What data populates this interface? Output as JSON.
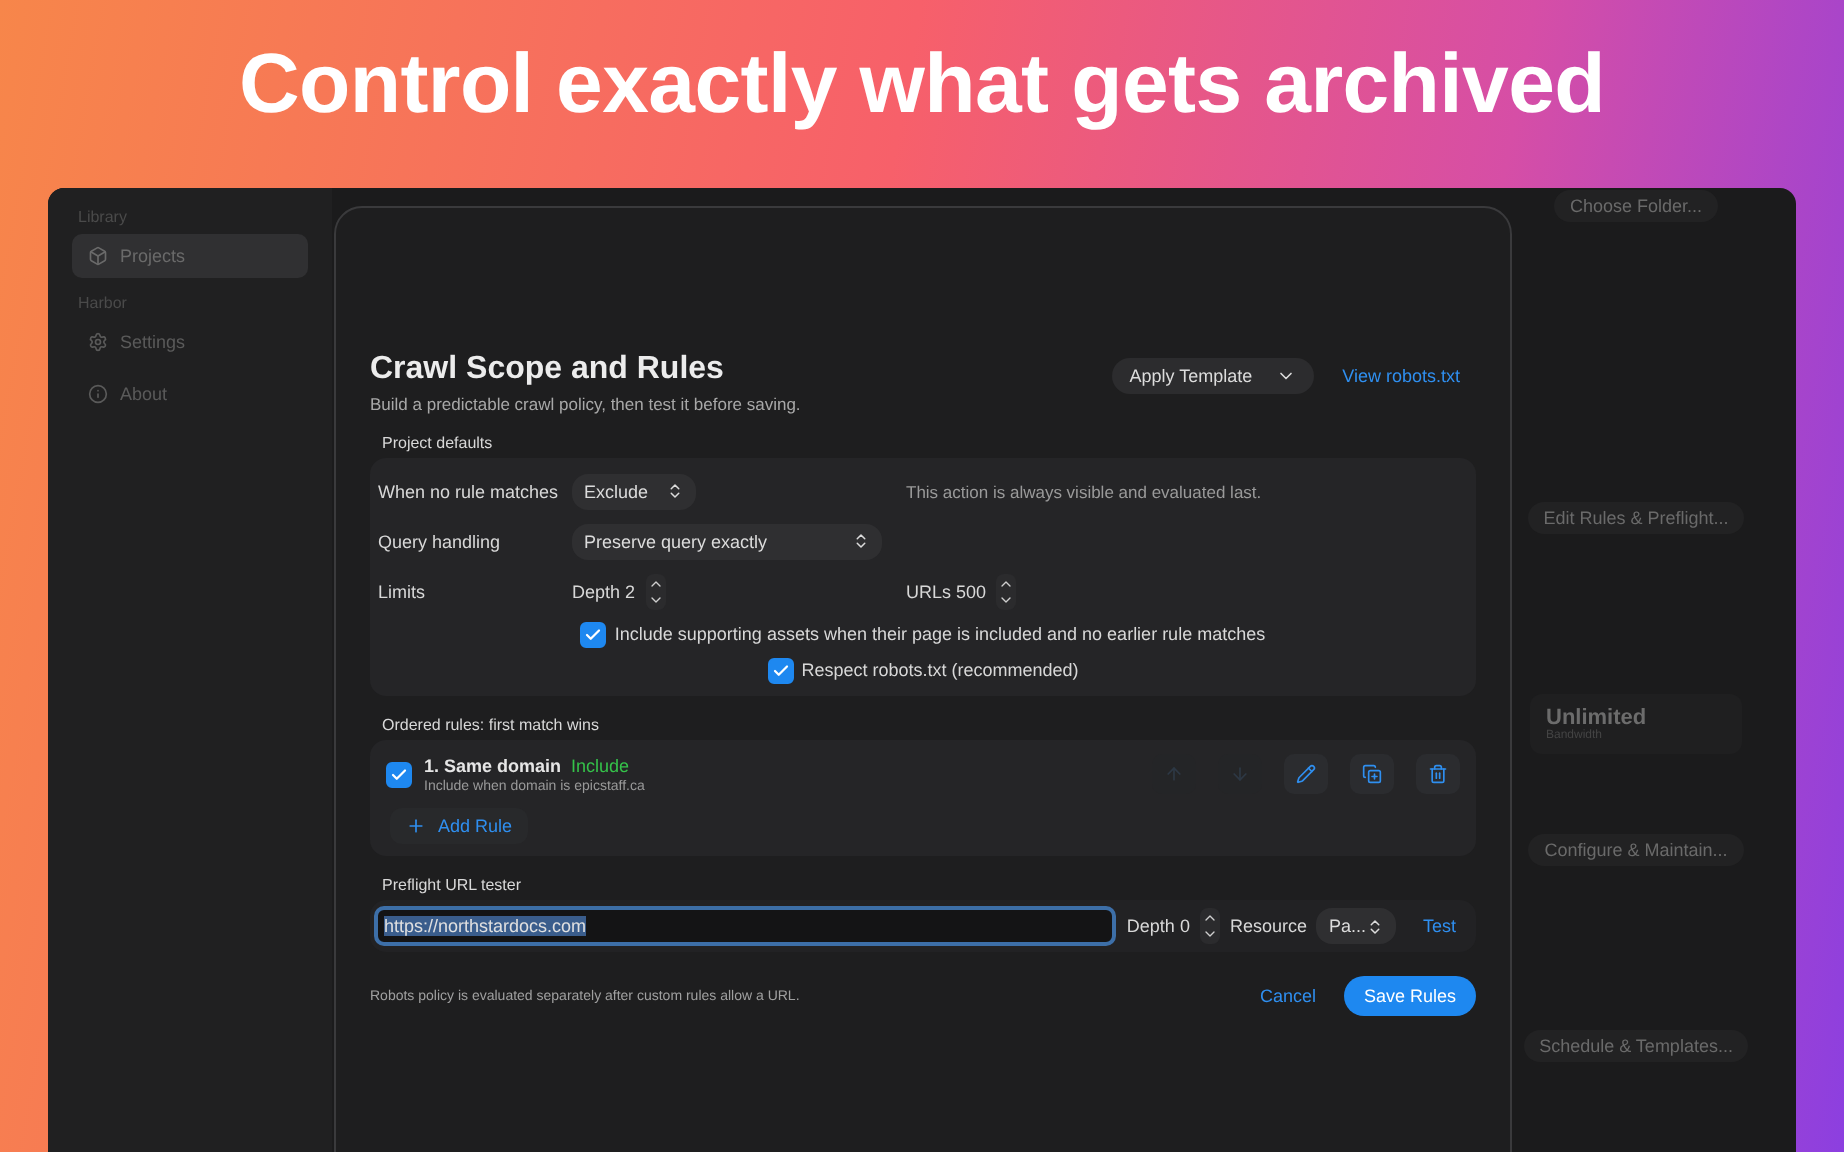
{
  "headline": "Control exactly what gets archived",
  "sidebar": {
    "sections": [
      {
        "title": "Library",
        "items": [
          {
            "label": "Projects",
            "selected": true
          }
        ]
      },
      {
        "title": "Harbor",
        "items": [
          {
            "label": "Settings",
            "selected": false
          },
          {
            "label": "About",
            "selected": false
          }
        ]
      }
    ]
  },
  "background_items": [
    {
      "kind": "button",
      "label": "Choose Folder..."
    },
    {
      "kind": "button",
      "label": "Edit Rules & Preflight..."
    },
    {
      "kind": "stat",
      "value": "Unlimited",
      "label": "Bandwidth"
    },
    {
      "kind": "button",
      "label": "Configure & Maintain..."
    },
    {
      "kind": "button",
      "label": "Schedule & Templates..."
    }
  ],
  "dialog": {
    "title": "Crawl Scope and Rules",
    "subtitle": "Build a predictable crawl policy, then test it before saving.",
    "template_menu": "Apply Template",
    "robots_link": "View robots.txt",
    "defaults": {
      "heading": "Project defaults",
      "rows": [
        {
          "kind": "select",
          "label": "When no rule matches",
          "value": "Exclude",
          "hint": "This action is always visible and evaluated last."
        },
        {
          "kind": "select",
          "label": "Query handling",
          "value": "Preserve query exactly"
        },
        {
          "kind": "steppers",
          "label": "Limits",
          "fields": [
            "Depth 2",
            "URLs 500"
          ]
        }
      ],
      "options": [
        {
          "label": "Include supporting assets when their page is included and no earlier rule matches",
          "checked": true
        },
        {
          "label": "Respect robots.txt (recommended)",
          "checked": true
        }
      ]
    },
    "rules": {
      "heading": "Ordered rules: first match wins",
      "items": [
        {
          "enabled": true,
          "title": "1. Same domain",
          "action": "Include",
          "detail": "Include when domain is epicstaff.ca",
          "controls": [
            {
              "kind": "up",
              "disabled": true
            },
            {
              "kind": "down",
              "disabled": true
            },
            {
              "kind": "edit",
              "disabled": false
            },
            {
              "kind": "duplicate",
              "disabled": false
            },
            {
              "kind": "delete",
              "disabled": false
            }
          ]
        }
      ],
      "add_label": "Add Rule"
    },
    "tester": {
      "heading": "Preflight URL tester",
      "url": "https://northstardocs.com",
      "url_selected": true,
      "depth": "Depth 0",
      "resource_label": "Resource",
      "resource_value": "Pa...",
      "test_label": "Test"
    },
    "footer_note": "Robots policy is evaluated separately after custom rules allow a URL.",
    "cancel_label": "Cancel",
    "save_label": "Save Rules"
  }
}
